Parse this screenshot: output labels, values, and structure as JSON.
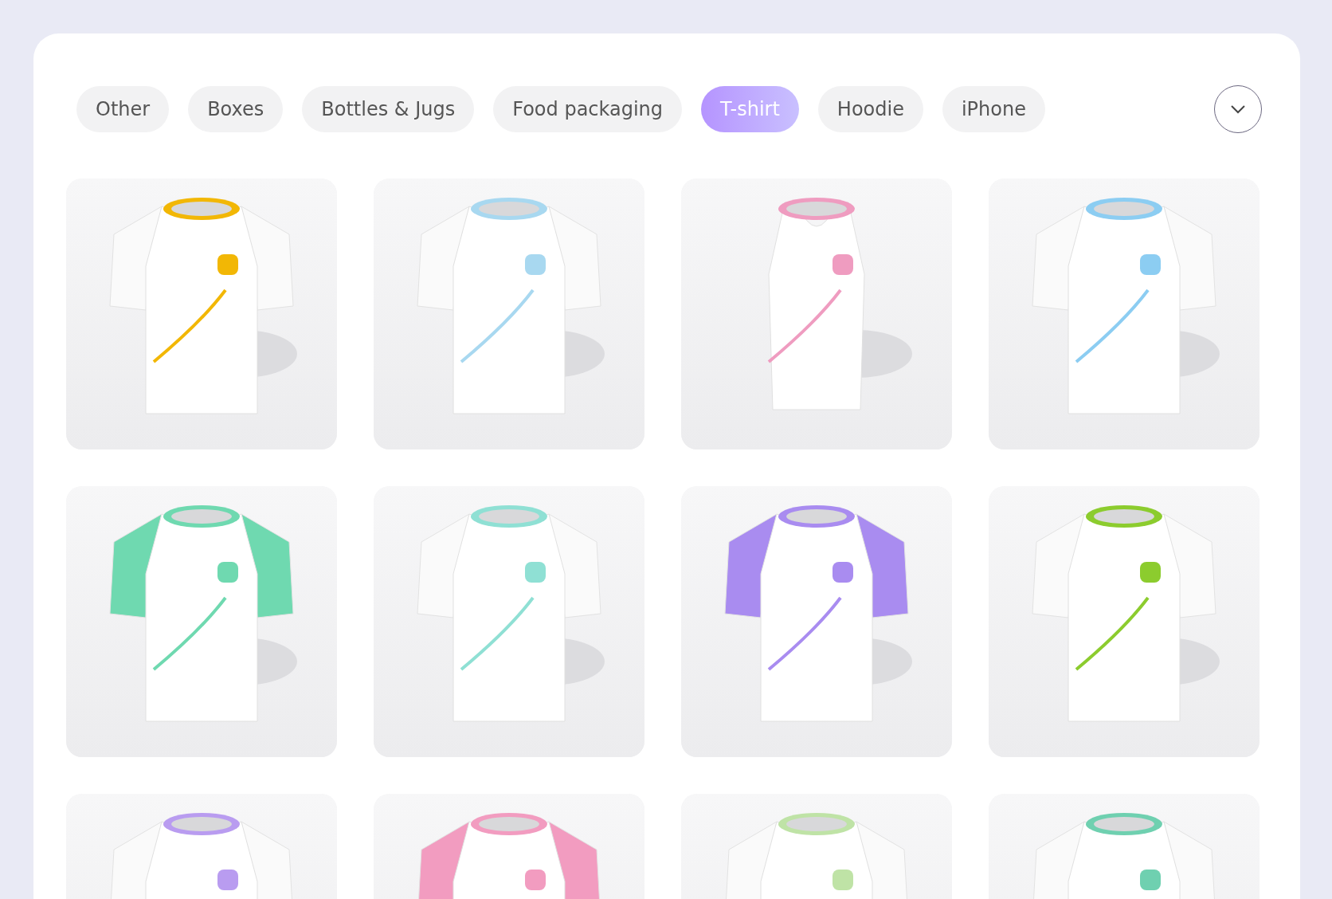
{
  "tabs": [
    {
      "label": "Other",
      "selected": false
    },
    {
      "label": "Boxes",
      "selected": false
    },
    {
      "label": "Bottles & Jugs",
      "selected": false
    },
    {
      "label": "Food packaging",
      "selected": false
    },
    {
      "label": "T-shirt",
      "selected": true
    },
    {
      "label": "Hoodie",
      "selected": false
    },
    {
      "label": "iPhone",
      "selected": false
    }
  ]
}
